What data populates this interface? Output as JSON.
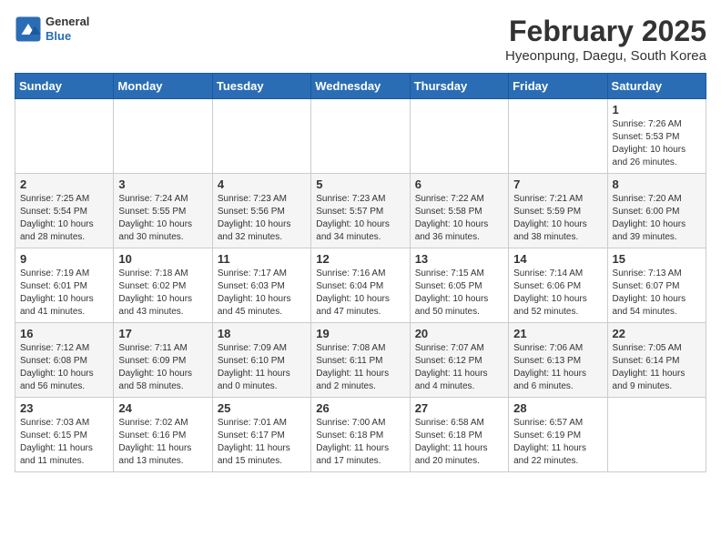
{
  "header": {
    "logo_general": "General",
    "logo_blue": "Blue",
    "title": "February 2025",
    "subtitle": "Hyeonpung, Daegu, South Korea"
  },
  "weekdays": [
    "Sunday",
    "Monday",
    "Tuesday",
    "Wednesday",
    "Thursday",
    "Friday",
    "Saturday"
  ],
  "weeks": [
    [
      {
        "day": "",
        "info": ""
      },
      {
        "day": "",
        "info": ""
      },
      {
        "day": "",
        "info": ""
      },
      {
        "day": "",
        "info": ""
      },
      {
        "day": "",
        "info": ""
      },
      {
        "day": "",
        "info": ""
      },
      {
        "day": "1",
        "info": "Sunrise: 7:26 AM\nSunset: 5:53 PM\nDaylight: 10 hours and 26 minutes."
      }
    ],
    [
      {
        "day": "2",
        "info": "Sunrise: 7:25 AM\nSunset: 5:54 PM\nDaylight: 10 hours and 28 minutes."
      },
      {
        "day": "3",
        "info": "Sunrise: 7:24 AM\nSunset: 5:55 PM\nDaylight: 10 hours and 30 minutes."
      },
      {
        "day": "4",
        "info": "Sunrise: 7:23 AM\nSunset: 5:56 PM\nDaylight: 10 hours and 32 minutes."
      },
      {
        "day": "5",
        "info": "Sunrise: 7:23 AM\nSunset: 5:57 PM\nDaylight: 10 hours and 34 minutes."
      },
      {
        "day": "6",
        "info": "Sunrise: 7:22 AM\nSunset: 5:58 PM\nDaylight: 10 hours and 36 minutes."
      },
      {
        "day": "7",
        "info": "Sunrise: 7:21 AM\nSunset: 5:59 PM\nDaylight: 10 hours and 38 minutes."
      },
      {
        "day": "8",
        "info": "Sunrise: 7:20 AM\nSunset: 6:00 PM\nDaylight: 10 hours and 39 minutes."
      }
    ],
    [
      {
        "day": "9",
        "info": "Sunrise: 7:19 AM\nSunset: 6:01 PM\nDaylight: 10 hours and 41 minutes."
      },
      {
        "day": "10",
        "info": "Sunrise: 7:18 AM\nSunset: 6:02 PM\nDaylight: 10 hours and 43 minutes."
      },
      {
        "day": "11",
        "info": "Sunrise: 7:17 AM\nSunset: 6:03 PM\nDaylight: 10 hours and 45 minutes."
      },
      {
        "day": "12",
        "info": "Sunrise: 7:16 AM\nSunset: 6:04 PM\nDaylight: 10 hours and 47 minutes."
      },
      {
        "day": "13",
        "info": "Sunrise: 7:15 AM\nSunset: 6:05 PM\nDaylight: 10 hours and 50 minutes."
      },
      {
        "day": "14",
        "info": "Sunrise: 7:14 AM\nSunset: 6:06 PM\nDaylight: 10 hours and 52 minutes."
      },
      {
        "day": "15",
        "info": "Sunrise: 7:13 AM\nSunset: 6:07 PM\nDaylight: 10 hours and 54 minutes."
      }
    ],
    [
      {
        "day": "16",
        "info": "Sunrise: 7:12 AM\nSunset: 6:08 PM\nDaylight: 10 hours and 56 minutes."
      },
      {
        "day": "17",
        "info": "Sunrise: 7:11 AM\nSunset: 6:09 PM\nDaylight: 10 hours and 58 minutes."
      },
      {
        "day": "18",
        "info": "Sunrise: 7:09 AM\nSunset: 6:10 PM\nDaylight: 11 hours and 0 minutes."
      },
      {
        "day": "19",
        "info": "Sunrise: 7:08 AM\nSunset: 6:11 PM\nDaylight: 11 hours and 2 minutes."
      },
      {
        "day": "20",
        "info": "Sunrise: 7:07 AM\nSunset: 6:12 PM\nDaylight: 11 hours and 4 minutes."
      },
      {
        "day": "21",
        "info": "Sunrise: 7:06 AM\nSunset: 6:13 PM\nDaylight: 11 hours and 6 minutes."
      },
      {
        "day": "22",
        "info": "Sunrise: 7:05 AM\nSunset: 6:14 PM\nDaylight: 11 hours and 9 minutes."
      }
    ],
    [
      {
        "day": "23",
        "info": "Sunrise: 7:03 AM\nSunset: 6:15 PM\nDaylight: 11 hours and 11 minutes."
      },
      {
        "day": "24",
        "info": "Sunrise: 7:02 AM\nSunset: 6:16 PM\nDaylight: 11 hours and 13 minutes."
      },
      {
        "day": "25",
        "info": "Sunrise: 7:01 AM\nSunset: 6:17 PM\nDaylight: 11 hours and 15 minutes."
      },
      {
        "day": "26",
        "info": "Sunrise: 7:00 AM\nSunset: 6:18 PM\nDaylight: 11 hours and 17 minutes."
      },
      {
        "day": "27",
        "info": "Sunrise: 6:58 AM\nSunset: 6:18 PM\nDaylight: 11 hours and 20 minutes."
      },
      {
        "day": "28",
        "info": "Sunrise: 6:57 AM\nSunset: 6:19 PM\nDaylight: 11 hours and 22 minutes."
      },
      {
        "day": "",
        "info": ""
      }
    ]
  ]
}
